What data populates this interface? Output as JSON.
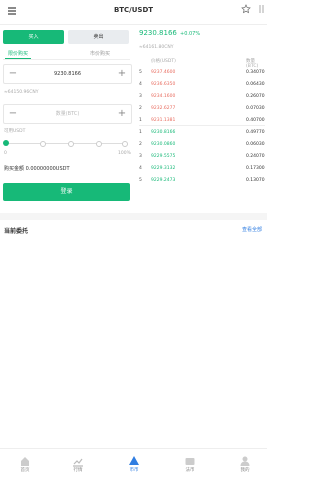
{
  "header": {
    "title": "BTC/USDT",
    "menu_icon": "list-icon",
    "star_icon": "star-icon",
    "more_icon": "share-icon"
  },
  "trade": {
    "tabs": {
      "buy": "买入",
      "sell": "卖出"
    },
    "order_types": {
      "limit": "限价购买",
      "market": "市价购买"
    },
    "price": {
      "value": "9230.8166",
      "minus": "−",
      "plus": "+"
    },
    "price_cny": "≈64150.96CNY",
    "amount": {
      "placeholder": "数量(BTC)",
      "minus": "−",
      "plus": "+"
    },
    "available": "可用USDT",
    "slider": {
      "min": "0",
      "max": "100%",
      "value_pct": 0
    },
    "total": "购买金额 0.00000000USDT",
    "submit": "登录"
  },
  "ticker": {
    "price": "9230.8166",
    "change": "+0.07%",
    "cny": "≈64161.80CNY"
  },
  "orderbook": {
    "headers": {
      "price": "价格(USDT)",
      "amount": "数量(BTC)"
    },
    "asks": [
      {
        "idx": "5",
        "price": "9237.4600",
        "amount": "0.34070"
      },
      {
        "idx": "4",
        "price": "9236.6350",
        "amount": "0.06430"
      },
      {
        "idx": "3",
        "price": "9234.1600",
        "amount": "0.26070"
      },
      {
        "idx": "2",
        "price": "9232.6277",
        "amount": "0.07030"
      },
      {
        "idx": "1",
        "price": "9231.1381",
        "amount": "0.40700"
      }
    ],
    "bids": [
      {
        "idx": "1",
        "price": "9230.8166",
        "amount": "0.49770"
      },
      {
        "idx": "2",
        "price": "9230.0860",
        "amount": "0.06030"
      },
      {
        "idx": "3",
        "price": "9229.5575",
        "amount": "0.24070"
      },
      {
        "idx": "4",
        "price": "9229.3132",
        "amount": "0.17300"
      },
      {
        "idx": "5",
        "price": "9229.2473",
        "amount": "0.13070"
      }
    ]
  },
  "current_orders": {
    "title": "当前委托",
    "view_all": "查看全部"
  },
  "nav": [
    {
      "label": "首页",
      "icon": "home-icon"
    },
    {
      "label": "行情",
      "icon": "chart-icon"
    },
    {
      "label": "币币",
      "icon": "trade-icon"
    },
    {
      "label": "法币",
      "icon": "wallet-icon"
    },
    {
      "label": "我的",
      "icon": "user-icon"
    }
  ],
  "colors": {
    "accent": "#17b978",
    "ask": "#e86b5e",
    "link": "#2f7de1"
  }
}
